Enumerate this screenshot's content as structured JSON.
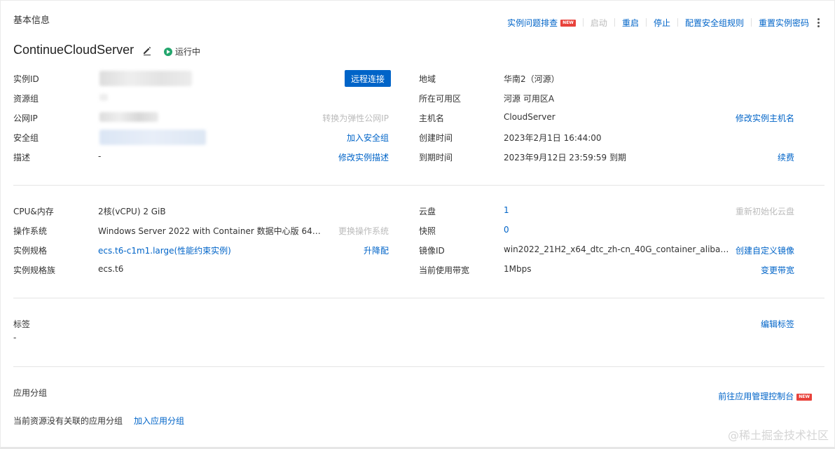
{
  "section_title": "基本信息",
  "actions": [
    {
      "label": "实例问题排查",
      "badge": "NEW",
      "disabled": false
    },
    {
      "label": "启动",
      "disabled": true
    },
    {
      "label": "重启",
      "disabled": false
    },
    {
      "label": "停止",
      "disabled": false
    },
    {
      "label": "配置安全组规则",
      "disabled": false
    },
    {
      "label": "重置实例密码",
      "disabled": false
    }
  ],
  "instance": {
    "name": "ContinueCloudServer",
    "status": "运行中",
    "status_color": "#23a66d"
  },
  "left_fields": {
    "instance_id_label": "实例ID",
    "remote_btn": "远程连接",
    "resource_group_label": "资源组",
    "public_ip_label": "公网IP",
    "convert_eip": "转换为弹性公网IP",
    "security_group_label": "安全组",
    "add_sg": "加入安全组",
    "desc_label": "描述",
    "desc_value": "-",
    "edit_desc": "修改实例描述"
  },
  "right_fields": {
    "region_label": "地域",
    "region_value": "华南2（河源）",
    "zone_label": "所在可用区",
    "zone_value": "河源 可用区A",
    "hostname_label": "主机名",
    "hostname_value": "CloudServer",
    "edit_hostname": "修改实例主机名",
    "created_label": "创建时间",
    "created_value": "2023年2月1日 16:44:00",
    "expire_label": "到期时间",
    "expire_value": "2023年9月12日 23:59:59 到期",
    "renew": "续费"
  },
  "spec": {
    "cpu_label": "CPU&内存",
    "cpu_value": "2核(vCPU) 2 GiB",
    "os_label": "操作系统",
    "os_value": "Windows Server 2022 with Container 数据中心版 64…",
    "change_os": "更换操作系统",
    "type_label": "实例规格",
    "type_value": "ecs.t6-c1m1.large(性能约束实例)",
    "upgrade": "升降配",
    "family_label": "实例规格族",
    "family_value": "ecs.t6",
    "disk_label": "云盘",
    "disk_value": "1",
    "reinit_disk": "重新初始化云盘",
    "snapshot_label": "快照",
    "snapshot_value": "0",
    "image_label": "镜像ID",
    "image_value": "win2022_21H2_x64_dtc_zh-cn_40G_container_aliba…",
    "create_image": "创建自定义镜像",
    "bandwidth_label": "当前使用带宽",
    "bandwidth_value": "1Mbps",
    "change_bw": "变更带宽"
  },
  "tags": {
    "label": "标签",
    "value": "-",
    "edit": "编辑标签"
  },
  "app_group": {
    "label": "应用分组",
    "empty_text": "当前资源没有关联的应用分组",
    "add": "加入应用分组",
    "goto": "前往应用管理控制台",
    "badge": "NEW"
  },
  "watermark": "@稀土掘金技术社区"
}
